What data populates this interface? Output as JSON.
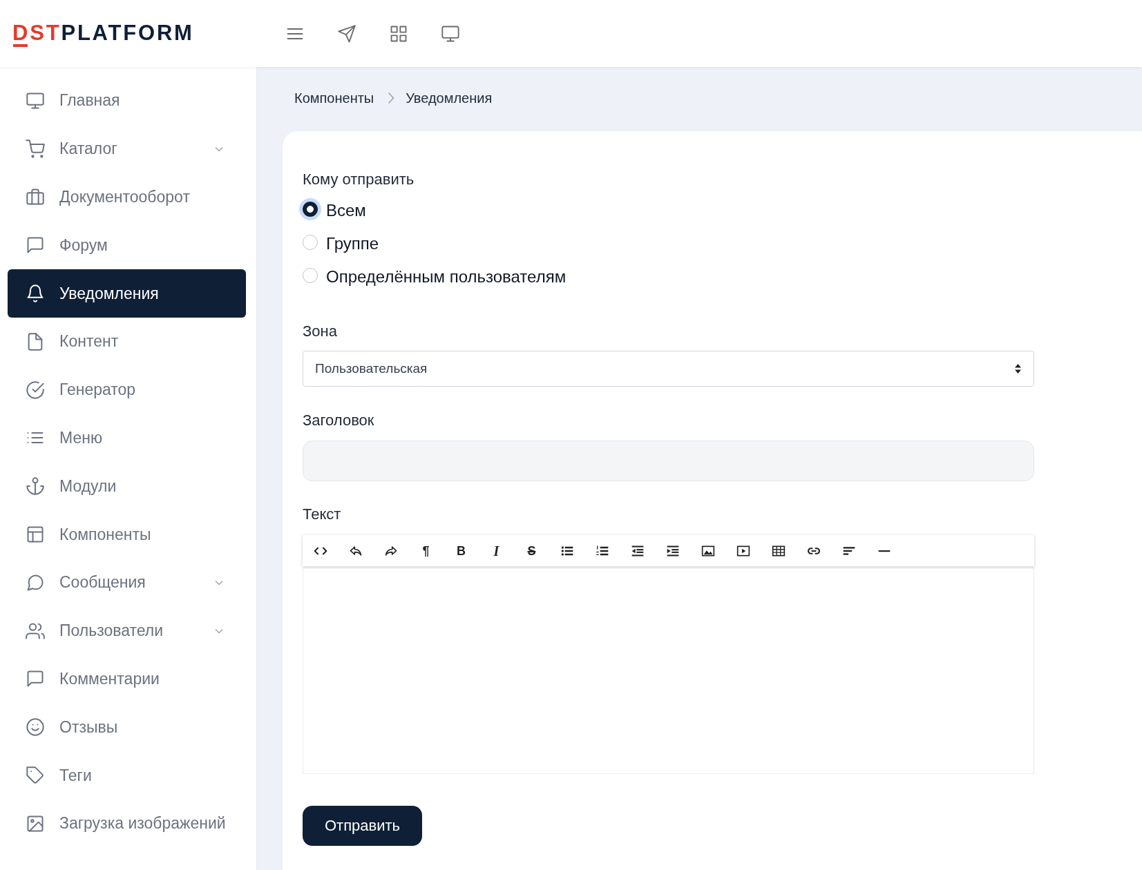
{
  "header": {
    "logo": {
      "accent": "DST",
      "rest": "PLATFORM"
    }
  },
  "sidebar": {
    "items": [
      {
        "label": "Главная",
        "kind": "link",
        "selected": false
      },
      {
        "label": "Каталог",
        "kind": "group",
        "selected": false
      },
      {
        "label": "Документооборот",
        "kind": "link",
        "selected": false
      },
      {
        "label": "Форум",
        "kind": "link",
        "selected": false
      },
      {
        "label": "Уведомления",
        "kind": "link",
        "selected": true
      },
      {
        "label": "Контент",
        "kind": "link",
        "selected": false
      },
      {
        "label": "Генератор",
        "kind": "link",
        "selected": false
      },
      {
        "label": "Меню",
        "kind": "link",
        "selected": false
      },
      {
        "label": "Модули",
        "kind": "link",
        "selected": false
      },
      {
        "label": "Компоненты",
        "kind": "link",
        "selected": false
      },
      {
        "label": "Сообщения",
        "kind": "group",
        "selected": false
      },
      {
        "label": "Пользователи",
        "kind": "group",
        "selected": false
      },
      {
        "label": "Комментарии",
        "kind": "link",
        "selected": false
      },
      {
        "label": "Отзывы",
        "kind": "link",
        "selected": false
      },
      {
        "label": "Теги",
        "kind": "link",
        "selected": false
      },
      {
        "label": "Загрузка изображений",
        "kind": "link",
        "selected": false
      }
    ]
  },
  "breadcrumb": [
    "Компоненты",
    "Уведомления"
  ],
  "form": {
    "recipients": {
      "label": "Кому отправить",
      "options": [
        {
          "label": "Всем",
          "selected": true
        },
        {
          "label": "Группе",
          "selected": false
        },
        {
          "label": "Определённым пользователям",
          "selected": false
        }
      ]
    },
    "zone": {
      "label": "Зона",
      "value": "Пользовательская"
    },
    "title": {
      "label": "Заголовок"
    },
    "text": {
      "label": "Текст",
      "toolbar": {
        "paragraph": "¶",
        "bold": "B",
        "italic": "I",
        "strikethrough": "S"
      }
    },
    "submit": "Отправить"
  }
}
